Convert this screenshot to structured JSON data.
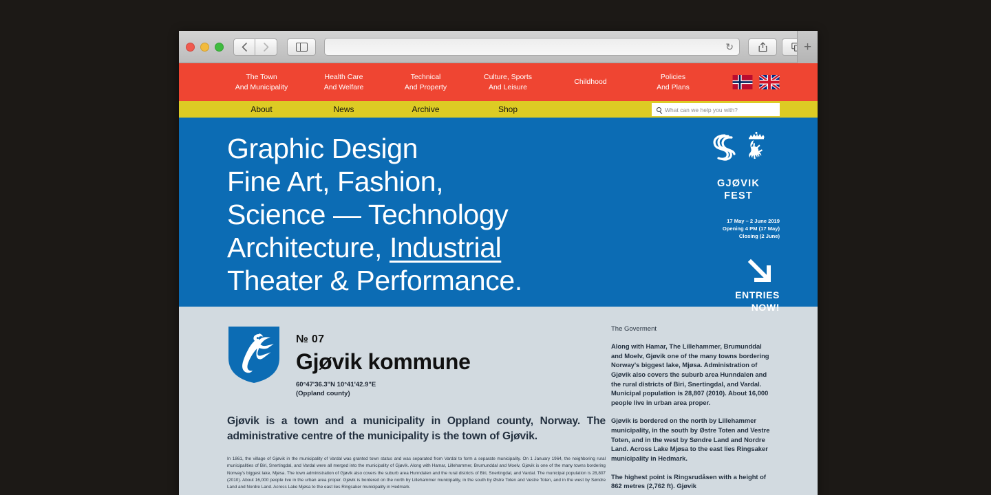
{
  "browser": {
    "url_value": "",
    "back_icon": "chevron-left-icon",
    "forward_icon": "chevron-right-icon",
    "sidebar_icon": "sidebar-toggle-icon",
    "reload_icon": "↻",
    "share_icon": "⇧",
    "tabs_icon": "⧉",
    "new_tab_label": "+"
  },
  "nav_primary": {
    "items": [
      {
        "line1": "The Town",
        "line2": "And Municipality"
      },
      {
        "line1": "Health Care",
        "line2": "And Welfare"
      },
      {
        "line1": "Technical",
        "line2": "And Property"
      },
      {
        "line1": "Culture, Sports",
        "line2": "And Leisure"
      },
      {
        "line1": "Childhood",
        "line2": ""
      },
      {
        "line1": "Policies",
        "line2": "And Plans"
      }
    ],
    "flags": [
      {
        "name": "norway-flag"
      },
      {
        "name": "uk-flag"
      }
    ]
  },
  "nav_secondary": {
    "items": [
      "About",
      "News",
      "Archive",
      "Shop"
    ],
    "search_placeholder": "What can we help you with?",
    "search_value": ""
  },
  "hero": {
    "lines": [
      {
        "text": "Graphic Design",
        "underline": ""
      },
      {
        "text": "Fine Art, Fashion,",
        "underline": ""
      },
      {
        "text": "Science — Technology",
        "underline": ""
      },
      {
        "text": "Architecture, ",
        "underline": "Industrial"
      },
      {
        "text": "Theater & Performance.",
        "underline": ""
      }
    ],
    "festival_name_line1": "GJØVIK",
    "festival_name_line2": "FEST",
    "dates_line1": "17 May – 2 June 2019",
    "dates_line2": "Opening 4 PM (17 May)",
    "dates_line3": "Closing (2 June)",
    "entries_line1": "ENTRIES",
    "entries_line2": "NOW!"
  },
  "content": {
    "number": "№ 07",
    "title": "Gjøvik kommune",
    "coords": "60°47'36.3\"N 10°41'42.9\"E",
    "county": "(Oppland county)",
    "lede": "Gjøvik is a town and a municipality in Oppland county, Norway. The administrative centre of the municipality is the town of Gjøvik.",
    "body": "In 1861, the village of Gjøvik in the municipality of Vardal was granted town status and was separated from Vardal to form a separate municipality. On 1 January 1964, the neighboring rural municipalities of Biri, Snertingdal, and Vardal were all merged into the municipality of Gjøvik. Along with Hamar, Lillehammer, Brumunddal and Moelv, Gjøvik is one of the many towns bordering Norway's biggest lake, Mjøsa. The town administration of Gjøvik also covers the suburb area Hunndalen and the rural districts of Biri, Snertingdal, and Vardal. The municipal population is 28,807 (2010). About 16,000 people live in the urban area proper. Gjøvik is bordered on the north by Lillehammer municipality, in the south by Østre Toten and Vestre Toten, and in the west by Søndre Land and Nordre Land. Across Lake Mjøsa to the east lies Ringsaker municipality in Hedmark."
  },
  "sidebar": {
    "heading": "The Goverment",
    "paragraphs": [
      "Along with Hamar, The Lillehammer, Brumunddal and Moelv, Gjøvik one of the many towns bordering Norway's biggest lake, Mjøsa. Administration of Gjøvik also covers the suburb area Hunndalen and the rural districts of Biri, Snertingdal, and Vardal. Municipal population is 28,807 (2010). About 16,000 people live in urban area proper.",
      "Gjøvik is bordered on the north by Lillehammer municipality, in the south by Østre Toten and Vestre Toten, and in the west by Søndre Land and Nordre Land. Across Lake Mjøsa to the east lies Ringsaker municipality in Hedmark.",
      "The highest point is Ringsrudåsen with a height of 862 metres (2,762 ft). Gjøvik"
    ]
  },
  "colors": {
    "red": "#ef4532",
    "yellow": "#ddcb24",
    "blue": "#0c6cb4",
    "content_bg": "#d2dae0"
  }
}
